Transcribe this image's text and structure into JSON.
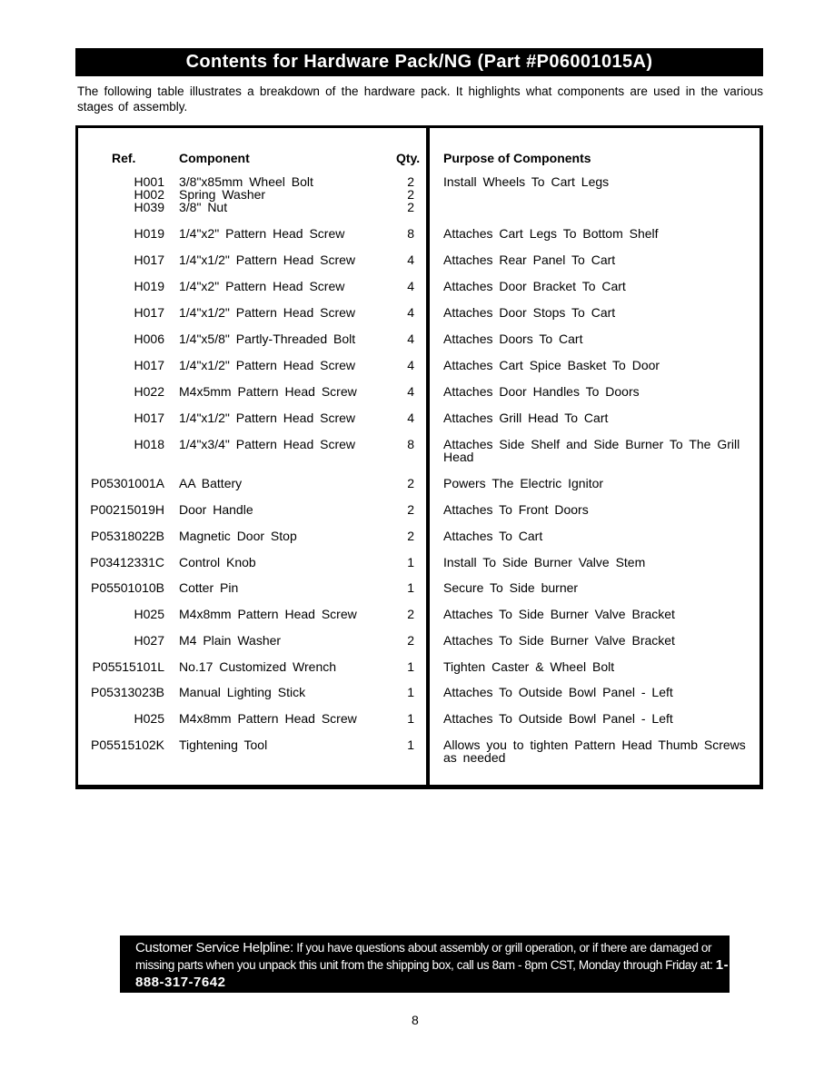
{
  "title": "Contents for Hardware Pack/NG (Part #P06001015A)",
  "intro": "The following table illustrates a breakdown of the hardware pack. It highlights what components are used in the various stages of assembly.",
  "table": {
    "headers": {
      "ref": "Ref.",
      "component": "Component",
      "qty": "Qty.",
      "purpose": "Purpose of Components"
    },
    "rows": [
      {
        "ref": "H001",
        "component": "3/8\"x85mm Wheel Bolt",
        "qty": "2",
        "purpose": "Install Wheels To Cart Legs"
      },
      {
        "ref": "H002",
        "component": "Spring Washer",
        "qty": "2",
        "purpose": ""
      },
      {
        "ref": "H039",
        "component": "3/8\" Nut",
        "qty": "2",
        "purpose": ""
      },
      {
        "ref": "H019",
        "component": "1/4\"x2\" Pattern Head Screw",
        "qty": "8",
        "purpose": "Attaches Cart Legs To Bottom Shelf"
      },
      {
        "ref": "H017",
        "component": "1/4\"x1/2\" Pattern Head Screw",
        "qty": "4",
        "purpose": "Attaches Rear Panel To Cart"
      },
      {
        "ref": "H019",
        "component": "1/4\"x2\" Pattern Head Screw",
        "qty": "4",
        "purpose": "Attaches Door Bracket To Cart"
      },
      {
        "ref": "H017",
        "component": "1/4\"x1/2\" Pattern Head Screw",
        "qty": "4",
        "purpose": "Attaches Door Stops To Cart"
      },
      {
        "ref": "H006",
        "component": "1/4\"x5/8\" Partly-Threaded Bolt",
        "qty": "4",
        "purpose": "Attaches Doors To Cart"
      },
      {
        "ref": "H017",
        "component": "1/4\"x1/2\" Pattern Head Screw",
        "qty": "4",
        "purpose": "Attaches Cart Spice Basket To Door"
      },
      {
        "ref": "H022",
        "component": "M4x5mm Pattern Head Screw",
        "qty": "4",
        "purpose": "Attaches Door Handles To Doors"
      },
      {
        "ref": "H017",
        "component": "1/4\"x1/2\" Pattern Head Screw",
        "qty": "4",
        "purpose": "Attaches Grill Head To Cart"
      },
      {
        "ref": "H018",
        "component": "1/4\"x3/4\" Pattern Head Screw",
        "qty": "8",
        "purpose": "Attaches Side Shelf and Side Burner To The Grill Head"
      },
      {
        "ref": "P05301001A",
        "component": "AA Battery",
        "qty": "2",
        "purpose": "Powers The Electric Ignitor"
      },
      {
        "ref": "P00215019H",
        "component": "Door Handle",
        "qty": "2",
        "purpose": "Attaches To Front Doors"
      },
      {
        "ref": "P05318022B",
        "component": "Magnetic Door Stop",
        "qty": "2",
        "purpose": "Attaches To Cart"
      },
      {
        "ref": "P03412331C",
        "component": "Control Knob",
        "qty": "1",
        "purpose": "Install To Side Burner Valve Stem"
      },
      {
        "ref": "P05501010B",
        "component": "Cotter Pin",
        "qty": "1",
        "purpose": "Secure To Side burner"
      },
      {
        "ref": "H025",
        "component": "M4x8mm Pattern Head Screw",
        "qty": "2",
        "purpose": "Attaches To Side Burner Valve Bracket"
      },
      {
        "ref": "H027",
        "component": "M4 Plain Washer",
        "qty": "2",
        "purpose": "Attaches To Side Burner Valve Bracket"
      },
      {
        "ref": "P05515101L",
        "component": "No.17 Customized Wrench",
        "qty": "1",
        "purpose": "Tighten Caster & Wheel Bolt"
      },
      {
        "ref": "P05313023B",
        "component": "Manual Lighting Stick",
        "qty": "1",
        "purpose": "Attaches To Outside Bowl Panel - Left"
      },
      {
        "ref": "H025",
        "component": "M4x8mm Pattern Head Screw",
        "qty": "1",
        "purpose": "Attaches To Outside Bowl Panel - Left"
      },
      {
        "ref": "P05515102K",
        "component": "Tightening Tool",
        "qty": "1",
        "purpose": "Allows you to tighten Pattern Head Thumb Screws as needed"
      }
    ]
  },
  "helpline": {
    "lead": "Customer Service Helpline:",
    "body": "If you have questions about assembly or grill operation, or if there are damaged or missing parts when you unpack this unit from the shipping box, call us  8am - 8pm CST, Monday through Friday at:",
    "phone": "1-888-317-7642"
  },
  "page_number": "8"
}
